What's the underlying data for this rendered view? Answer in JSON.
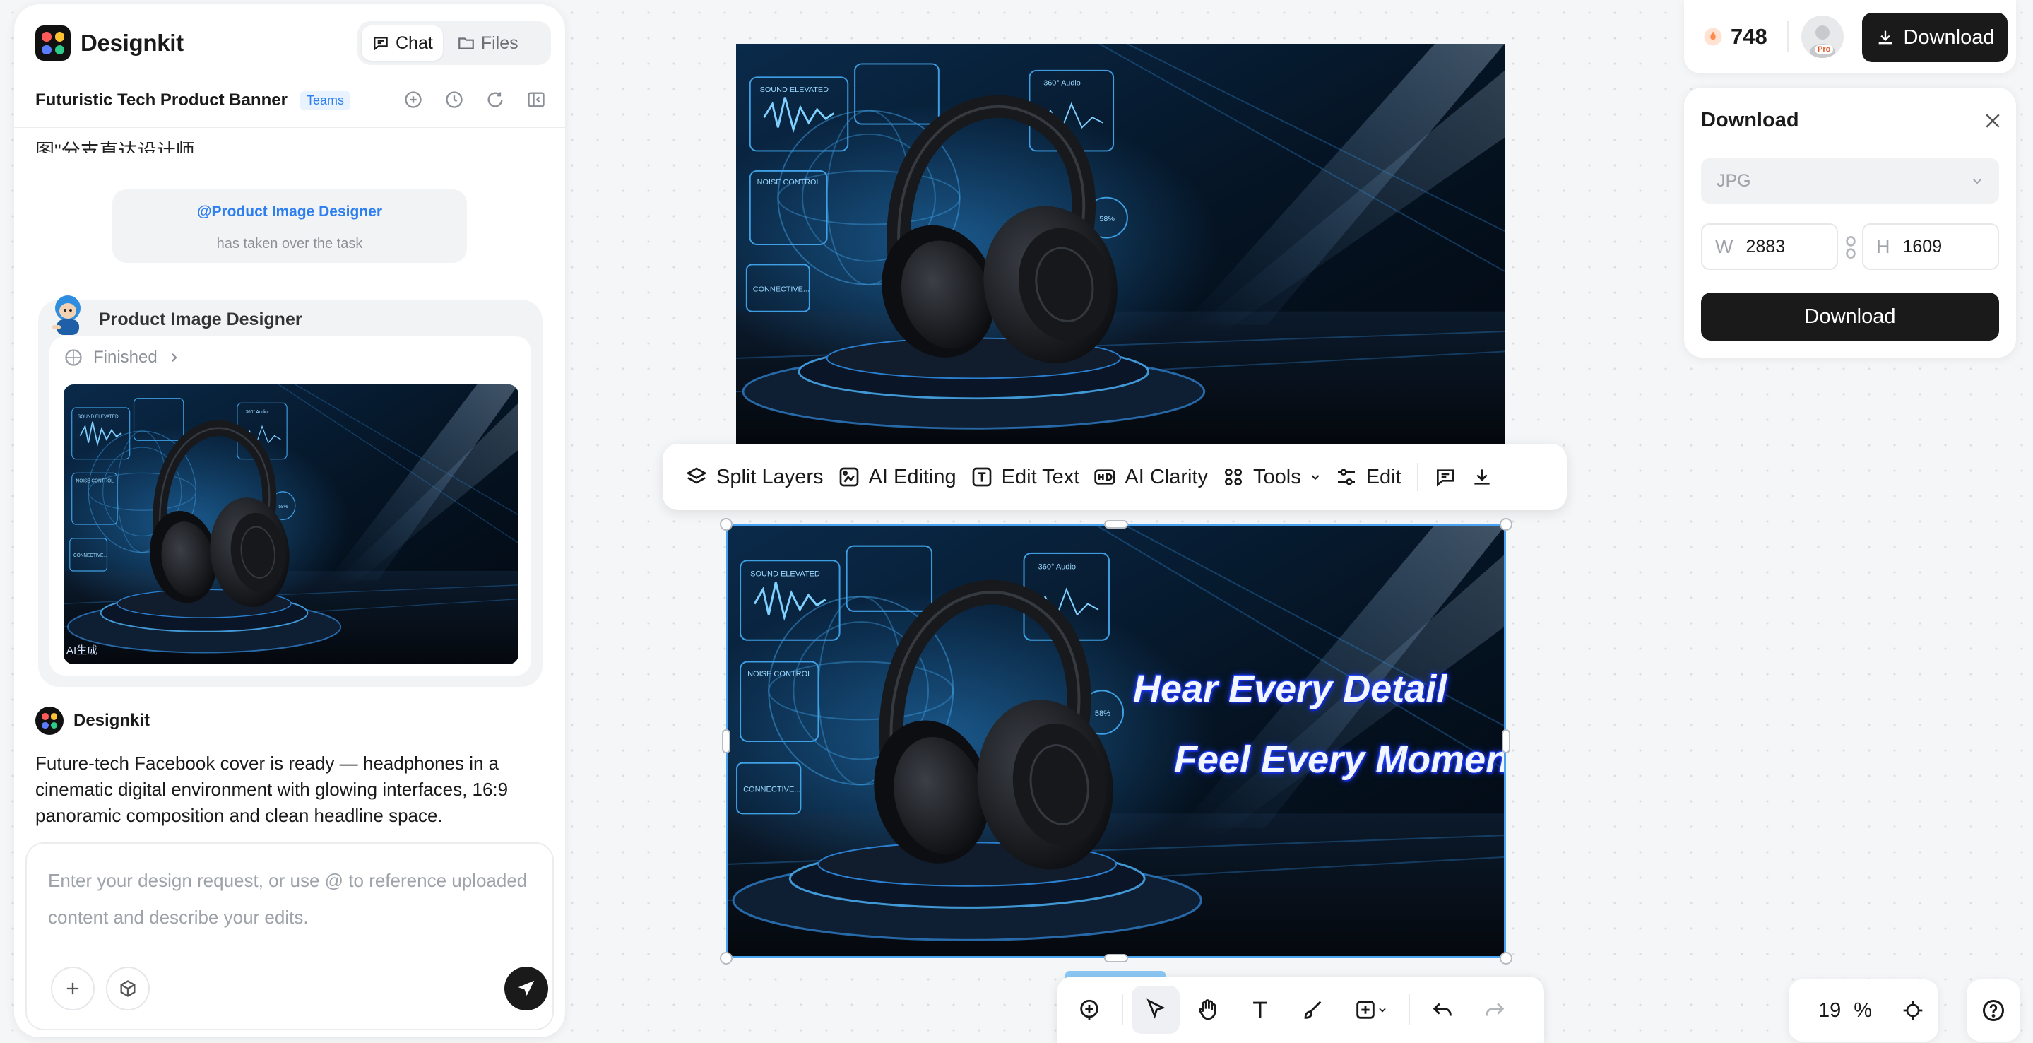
{
  "app": {
    "brand": "Designkit"
  },
  "tabs": [
    {
      "label": "Chat",
      "active": true
    },
    {
      "label": "Files",
      "active": false
    }
  ],
  "project": {
    "title": "Futuristic Tech Product Banner",
    "badge": "Teams"
  },
  "chat": {
    "cut_text": "图\"分支直达设计师。",
    "handoff": {
      "mention": "@Product Image Designer",
      "text": "has taken over the task"
    },
    "agent": {
      "name": "Product Image Designer",
      "status": "Finished",
      "image_tag": "AI生成"
    },
    "bot": {
      "name": "Designkit",
      "message": "Future-tech Facebook cover is ready — headphones in a cinematic digital environment with glowing interfaces, 16:9 panoramic composition and clean headline space."
    },
    "composer": {
      "placeholder": "Enter your design request, or use @ to reference uploaded content and describe your edits."
    }
  },
  "canvas": {
    "headline_1": "Hear Every Detail",
    "headline_2": "Feel Every Moment",
    "hud": {
      "sound": "SOUND ELEVATED",
      "audio": "360° Audio",
      "noise": "NOISE CONTROL",
      "connect": "CONNECTIVE...",
      "pct": "58%"
    }
  },
  "toolbar": {
    "split_layers": "Split Layers",
    "ai_editing": "AI Editing",
    "edit_text": "Edit Text",
    "ai_clarity": "AI Clarity",
    "tools": "Tools",
    "edit": "Edit"
  },
  "zoom": {
    "value": "19",
    "unit": "%"
  },
  "header": {
    "credits": "748",
    "pro_badge": "Pro",
    "download_label": "Download"
  },
  "download_panel": {
    "title": "Download",
    "format": "JPG",
    "width_label": "W",
    "width": "2883",
    "height_label": "H",
    "height": "1609",
    "button_label": "Download"
  },
  "colors": {
    "accent": "#2d7ff0",
    "selection": "#4aa3f0",
    "dark": "#1a1a1a"
  }
}
